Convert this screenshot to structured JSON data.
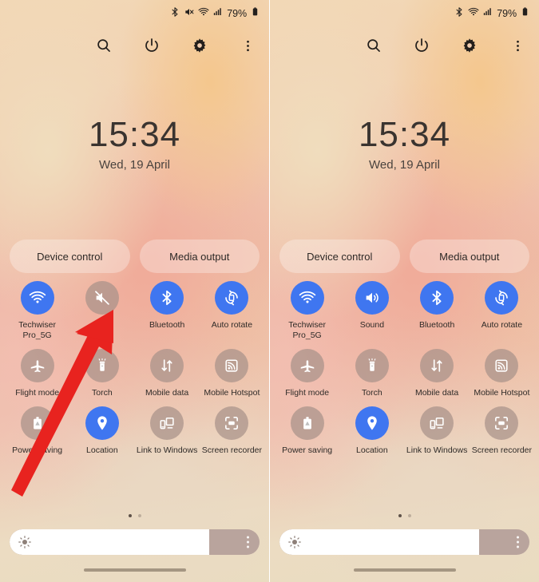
{
  "meta": {
    "accent_blue": "#3f76f0",
    "tile_off": "#a89289",
    "arrow_red": "#e8231f"
  },
  "panels": [
    {
      "id": "left",
      "status_bar": {
        "icons": [
          "bluetooth-icon",
          "mute-icon",
          "wifi-icon",
          "signal-icon"
        ],
        "battery_percent": "79%",
        "battery_icon": "battery-icon"
      },
      "header_icons": [
        "search-icon",
        "power-icon",
        "settings-gear-icon",
        "more-options-icon"
      ],
      "clock": {
        "time": "15:34",
        "date": "Wed, 19 April"
      },
      "pills": [
        {
          "label": "Device control",
          "name": "device-control-button"
        },
        {
          "label": "Media output",
          "name": "media-output-button"
        }
      ],
      "tiles": [
        {
          "label": "Techwiser Pro_5G",
          "icon": "wifi-icon",
          "active": true
        },
        {
          "label": "Mute",
          "icon": "volume-mute-icon",
          "active": false
        },
        {
          "label": "Bluetooth",
          "icon": "bluetooth-icon",
          "active": true
        },
        {
          "label": "Auto rotate",
          "icon": "auto-rotate-icon",
          "active": true
        },
        {
          "label": "Flight mode",
          "icon": "airplane-icon",
          "active": false
        },
        {
          "label": "Torch",
          "icon": "flashlight-icon",
          "active": false
        },
        {
          "label": "Mobile data",
          "icon": "mobile-data-icon",
          "active": false
        },
        {
          "label": "Mobile Hotspot",
          "icon": "hotspot-icon",
          "active": false
        },
        {
          "label": "Power saving",
          "icon": "power-saving-icon",
          "active": false
        },
        {
          "label": "Location",
          "icon": "location-pin-icon",
          "active": true
        },
        {
          "label": "Link to Windows",
          "icon": "link-to-windows-icon",
          "active": false
        },
        {
          "label": "Screen recorder",
          "icon": "screen-recorder-icon",
          "active": false
        }
      ],
      "page_dots": {
        "count": 2,
        "active_index": 0
      },
      "brightness": {
        "icon": "brightness-sun-icon",
        "fill_percent": 80,
        "menu_icon": "more-options-icon"
      },
      "annotation": {
        "type": "arrow",
        "points_to": "Mute",
        "color": "#e8231f"
      }
    },
    {
      "id": "right",
      "status_bar": {
        "icons": [
          "bluetooth-icon",
          "wifi-icon",
          "signal-icon"
        ],
        "battery_percent": "79%",
        "battery_icon": "battery-icon"
      },
      "header_icons": [
        "search-icon",
        "power-icon",
        "settings-gear-icon",
        "more-options-icon"
      ],
      "clock": {
        "time": "15:34",
        "date": "Wed, 19 April"
      },
      "pills": [
        {
          "label": "Device control",
          "name": "device-control-button"
        },
        {
          "label": "Media output",
          "name": "media-output-button"
        }
      ],
      "tiles": [
        {
          "label": "Techwiser Pro_5G",
          "icon": "wifi-icon",
          "active": true
        },
        {
          "label": "Sound",
          "icon": "volume-on-icon",
          "active": true
        },
        {
          "label": "Bluetooth",
          "icon": "bluetooth-icon",
          "active": true
        },
        {
          "label": "Auto rotate",
          "icon": "auto-rotate-icon",
          "active": true
        },
        {
          "label": "Flight mode",
          "icon": "airplane-icon",
          "active": false
        },
        {
          "label": "Torch",
          "icon": "flashlight-icon",
          "active": false
        },
        {
          "label": "Mobile data",
          "icon": "mobile-data-icon",
          "active": false
        },
        {
          "label": "Mobile Hotspot",
          "icon": "hotspot-icon",
          "active": false
        },
        {
          "label": "Power saving",
          "icon": "power-saving-icon",
          "active": false
        },
        {
          "label": "Location",
          "icon": "location-pin-icon",
          "active": true
        },
        {
          "label": "Link to Windows",
          "icon": "link-to-windows-icon",
          "active": false
        },
        {
          "label": "Screen recorder",
          "icon": "screen-recorder-icon",
          "active": false
        }
      ],
      "page_dots": {
        "count": 2,
        "active_index": 0
      },
      "brightness": {
        "icon": "brightness-sun-icon",
        "fill_percent": 80,
        "menu_icon": "more-options-icon"
      },
      "annotation": null
    }
  ]
}
